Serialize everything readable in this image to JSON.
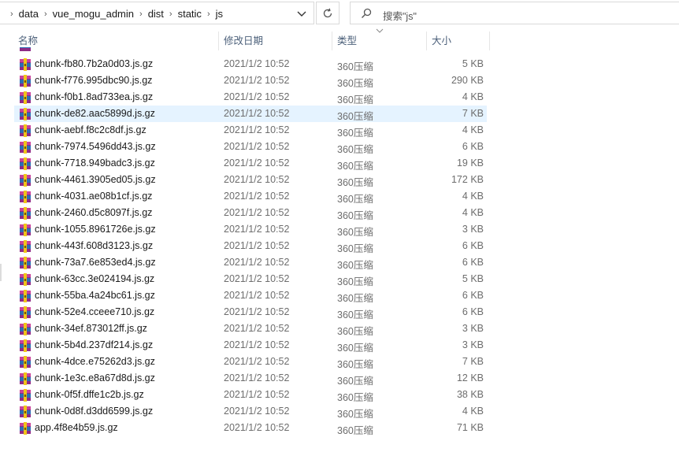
{
  "address": {
    "crumbs": [
      "data",
      "vue_mogu_admin",
      "dist",
      "static",
      "js"
    ],
    "refresh_icon": "refresh-icon",
    "dropdown_icon": "chevron-down-icon"
  },
  "search": {
    "placeholder": "搜索\"js\"",
    "icon": "search-icon"
  },
  "columns": {
    "name": "名称",
    "date": "修改日期",
    "type": "类型",
    "size": "大小"
  },
  "rows": [
    {
      "name": "chunk-fb80.7b2a0d03.js.gz",
      "date": "2021/1/2 10:52",
      "type": "360压缩",
      "size": "5 KB"
    },
    {
      "name": "chunk-f776.995dbc90.js.gz",
      "date": "2021/1/2 10:52",
      "type": "360压缩",
      "size": "290 KB"
    },
    {
      "name": "chunk-f0b1.8ad733ea.js.gz",
      "date": "2021/1/2 10:52",
      "type": "360压缩",
      "size": "4 KB"
    },
    {
      "name": "chunk-de82.aac5899d.js.gz",
      "date": "2021/1/2 10:52",
      "type": "360压缩",
      "size": "7 KB"
    },
    {
      "name": "chunk-aebf.f8c2c8df.js.gz",
      "date": "2021/1/2 10:52",
      "type": "360压缩",
      "size": "4 KB"
    },
    {
      "name": "chunk-7974.5496dd43.js.gz",
      "date": "2021/1/2 10:52",
      "type": "360压缩",
      "size": "6 KB"
    },
    {
      "name": "chunk-7718.949badc3.js.gz",
      "date": "2021/1/2 10:52",
      "type": "360压缩",
      "size": "19 KB"
    },
    {
      "name": "chunk-4461.3905ed05.js.gz",
      "date": "2021/1/2 10:52",
      "type": "360压缩",
      "size": "172 KB"
    },
    {
      "name": "chunk-4031.ae08b1cf.js.gz",
      "date": "2021/1/2 10:52",
      "type": "360压缩",
      "size": "4 KB"
    },
    {
      "name": "chunk-2460.d5c8097f.js.gz",
      "date": "2021/1/2 10:52",
      "type": "360压缩",
      "size": "4 KB"
    },
    {
      "name": "chunk-1055.8961726e.js.gz",
      "date": "2021/1/2 10:52",
      "type": "360压缩",
      "size": "3 KB"
    },
    {
      "name": "chunk-443f.608d3123.js.gz",
      "date": "2021/1/2 10:52",
      "type": "360压缩",
      "size": "6 KB"
    },
    {
      "name": "chunk-73a7.6e853ed4.js.gz",
      "date": "2021/1/2 10:52",
      "type": "360压缩",
      "size": "6 KB"
    },
    {
      "name": "chunk-63cc.3e024194.js.gz",
      "date": "2021/1/2 10:52",
      "type": "360压缩",
      "size": "5 KB"
    },
    {
      "name": "chunk-55ba.4a24bc61.js.gz",
      "date": "2021/1/2 10:52",
      "type": "360压缩",
      "size": "6 KB"
    },
    {
      "name": "chunk-52e4.cceee710.js.gz",
      "date": "2021/1/2 10:52",
      "type": "360压缩",
      "size": "6 KB"
    },
    {
      "name": "chunk-34ef.873012ff.js.gz",
      "date": "2021/1/2 10:52",
      "type": "360压缩",
      "size": "3 KB"
    },
    {
      "name": "chunk-5b4d.237df214.js.gz",
      "date": "2021/1/2 10:52",
      "type": "360压缩",
      "size": "3 KB"
    },
    {
      "name": "chunk-4dce.e75262d3.js.gz",
      "date": "2021/1/2 10:52",
      "type": "360压缩",
      "size": "7 KB"
    },
    {
      "name": "chunk-1e3c.e8a67d8d.js.gz",
      "date": "2021/1/2 10:52",
      "type": "360压缩",
      "size": "12 KB"
    },
    {
      "name": "chunk-0f5f.dffe1c2b.js.gz",
      "date": "2021/1/2 10:52",
      "type": "360压缩",
      "size": "38 KB"
    },
    {
      "name": "chunk-0d8f.d3dd6599.js.gz",
      "date": "2021/1/2 10:52",
      "type": "360压缩",
      "size": "4 KB"
    },
    {
      "name": "app.4f8e4b59.js.gz",
      "date": "2021/1/2 10:52",
      "type": "360压缩",
      "size": "71 KB"
    }
  ],
  "selected_row": 3,
  "file_icon": "archive-file-icon",
  "colors": {
    "selection": "#e5f3ff",
    "header_text": "#4c607a",
    "muted_text": "#6d6d6d"
  }
}
